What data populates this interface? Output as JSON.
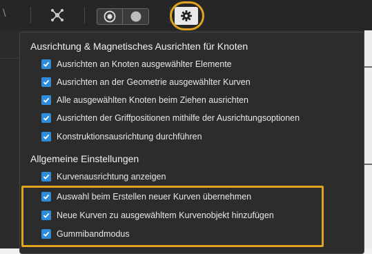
{
  "colors": {
    "toolbar_bg": "#262626",
    "popup_bg": "#2c2c2c",
    "checkbox_accent": "#2e8cdb",
    "highlight": "#e3a41d"
  },
  "toolbar": {
    "edge_glyph": "\\",
    "snap_icon": "node-snap-icon",
    "segment_left_icon": "ring-icon",
    "segment_right_icon": "disc-icon",
    "settings_icon": "gear-icon"
  },
  "popup": {
    "section1_title": "Ausrichtung & Magnetisches Ausrichten für Knoten",
    "section1_options": [
      {
        "label": "Ausrichten an Knoten ausgewählter Elemente",
        "checked": true
      },
      {
        "label": "Ausrichten an der Geometrie ausgewählter Kurven",
        "checked": true
      },
      {
        "label": "Alle ausgewählten Knoten beim Ziehen ausrichten",
        "checked": true
      },
      {
        "label": "Ausrichten der Griffpositionen mithilfe der Ausrichtungsoptionen",
        "checked": true
      },
      {
        "label": "Konstruktionsausrichtung durchführen",
        "checked": true
      }
    ],
    "section2_title": "Allgemeine Einstellungen",
    "section2_options": [
      {
        "label": "Kurvenausrichtung anzeigen",
        "checked": true
      },
      {
        "label": "Auswahl beim Erstellen neuer Kurven übernehmen",
        "checked": true
      },
      {
        "label": "Neue Kurven zu ausgewähltem Kurvenobjekt hinzufügen",
        "checked": true
      },
      {
        "label": "Gummibandmodus",
        "checked": true
      }
    ]
  }
}
